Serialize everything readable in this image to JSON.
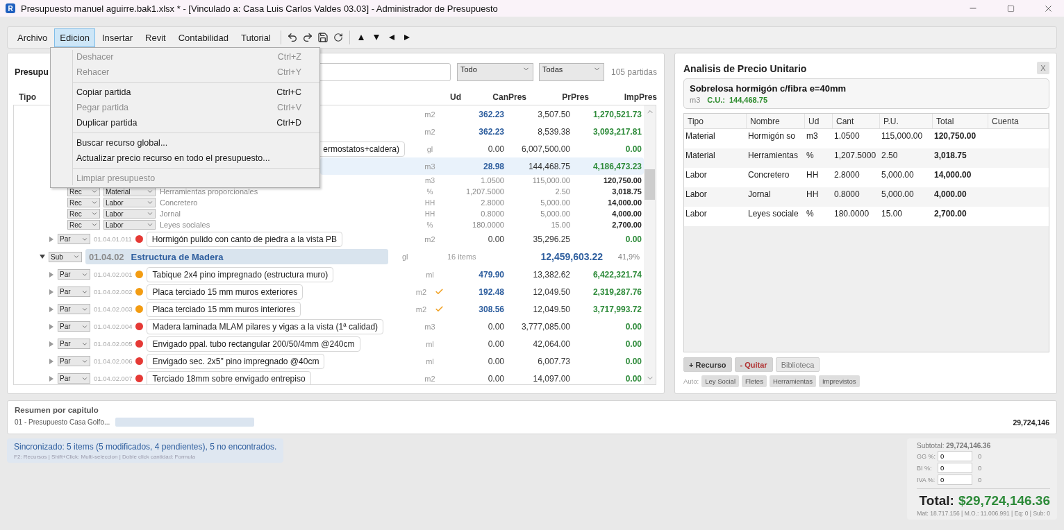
{
  "window": {
    "app_icon": "R",
    "title": "Presupuesto manuel aguirre.bak1.xlsx * - [Vinculado a: Casa Luis Carlos Valdes 03.03] - Administrador de Presupuesto"
  },
  "menu_bar": [
    {
      "label": "Archivo",
      "selected": false
    },
    {
      "label": "Edicion",
      "selected": true
    },
    {
      "label": "Insertar",
      "selected": false
    },
    {
      "label": "Revit",
      "selected": false
    },
    {
      "label": "Contabilidad",
      "selected": false
    },
    {
      "label": "Tutorial",
      "selected": false
    }
  ],
  "edit_menu": [
    {
      "kind": "item",
      "label": "Deshacer",
      "shortcut": "Ctrl+Z",
      "disabled": true
    },
    {
      "kind": "item",
      "label": "Rehacer",
      "shortcut": "Ctrl+Y",
      "disabled": true
    },
    {
      "kind": "separator"
    },
    {
      "kind": "item",
      "label": "Copiar partida",
      "shortcut": "Ctrl+C",
      "disabled": false
    },
    {
      "kind": "item",
      "label": "Pegar partida",
      "shortcut": "Ctrl+V",
      "disabled": true
    },
    {
      "kind": "item",
      "label": "Duplicar partida",
      "shortcut": "Ctrl+D",
      "disabled": false
    },
    {
      "kind": "separator"
    },
    {
      "kind": "item",
      "label": "Buscar recurso global...",
      "disabled": false
    },
    {
      "kind": "item",
      "label": "Actualizar precio recurso en todo el presupuesto...",
      "disabled": false
    },
    {
      "kind": "separator"
    },
    {
      "kind": "item",
      "label": "Limpiar presupuesto",
      "disabled": true
    }
  ],
  "budget": {
    "title": "Presupu",
    "filter_type": "Todo",
    "filter_chapter": "Todas",
    "count": "105 partidas",
    "columns": [
      "Tipo",
      "Ud",
      "CanPres",
      "PrPres",
      "ImpPres"
    ],
    "rows": [
      {
        "kind": "covered",
        "selected": false,
        "ud": "m2",
        "can": "362.23",
        "quantity_set": true,
        "pr": "3,507.50",
        "imp": "1,270,521.73"
      },
      {
        "kind": "covered",
        "selected": false,
        "ud": "m2",
        "can": "362.23",
        "quantity_set": true,
        "pr": "8,539.38",
        "imp": "3,093,217.81"
      },
      {
        "kind": "covered",
        "selected": false,
        "desc": "ermostatos+caldera)",
        "ud": "gl",
        "can": "0.00",
        "quantity_set": false,
        "pr": "6,007,500.00",
        "imp": "0.00"
      },
      {
        "kind": "covered",
        "selected": true,
        "ud": "m3",
        "can": "28.98",
        "quantity_set": true,
        "pr": "144,468.75",
        "imp": "4,186,473.23"
      },
      {
        "kind": "rec",
        "selected": false,
        "ud": "m3",
        "can": "1.0500",
        "pr": "115,000.00",
        "imp": "120,750.00"
      },
      {
        "kind": "rec",
        "selected": false,
        "level_select": "Rec",
        "type_select": "Material",
        "name": "Herramientas proporcionales",
        "ud": "%",
        "can": "1,207.5000",
        "pr": "2.50",
        "imp": "3,018.75"
      },
      {
        "kind": "rec",
        "selected": false,
        "level_select": "Rec",
        "type_select": "Labor",
        "name": "Concretero",
        "ud": "HH",
        "can": "2.8000",
        "pr": "5,000.00",
        "imp": "14,000.00"
      },
      {
        "kind": "rec",
        "selected": false,
        "level_select": "Rec",
        "type_select": "Labor",
        "name": "Jornal",
        "ud": "HH",
        "can": "0.8000",
        "pr": "5,000.00",
        "imp": "4,000.00"
      },
      {
        "kind": "rec",
        "selected": false,
        "level_select": "Rec",
        "type_select": "Labor",
        "name": "Leyes sociales",
        "ud": "%",
        "can": "180.0000",
        "pr": "15.00",
        "imp": "2,700.00"
      },
      {
        "kind": "par",
        "selected": false,
        "expanded": false,
        "level_select": "Par",
        "code": "01.04.01.011",
        "color": "#e53935",
        "desc": "Hormigón pulido con canto de piedra a la vista PB",
        "ud": "m2",
        "verified": false,
        "can": "0.00",
        "quantity_set": false,
        "pr": "35,296.25",
        "imp": "0.00"
      },
      {
        "kind": "sub",
        "selected": false,
        "expanded": true,
        "level_select": "Sub",
        "code": "01.04.02",
        "title": "Estructura de Madera",
        "ud": "gl",
        "items": "16 items",
        "total": "12,459,603.22",
        "share": "41,9%"
      },
      {
        "kind": "par",
        "selected": false,
        "expanded": false,
        "level_select": "Par",
        "code": "01.04.02.001",
        "color": "#f39c12",
        "desc": "Tabique 2x4 pino impregnado (estructura muro)",
        "ud": "ml",
        "verified": false,
        "can": "479.90",
        "quantity_set": true,
        "pr": "13,382.62",
        "imp": "6,422,321.74"
      },
      {
        "kind": "par",
        "selected": false,
        "expanded": false,
        "level_select": "Par",
        "code": "01.04.02.002",
        "color": "#f39c12",
        "desc": "Placa terciado 15 mm muros exteriores",
        "ud": "m2",
        "verified": true,
        "can": "192.48",
        "quantity_set": true,
        "pr": "12,049.50",
        "imp": "2,319,287.76"
      },
      {
        "kind": "par",
        "selected": false,
        "expanded": false,
        "level_select": "Par",
        "code": "01.04.02.003",
        "color": "#f39c12",
        "desc": "Placa terciado 15 mm muros interiores",
        "ud": "m2",
        "verified": true,
        "can": "308.56",
        "quantity_set": true,
        "pr": "12,049.50",
        "imp": "3,717,993.72"
      },
      {
        "kind": "par",
        "selected": false,
        "expanded": false,
        "level_select": "Par",
        "code": "01.04.02.004",
        "color": "#e53935",
        "desc": "Madera laminada MLAM pilares y vigas a la vista (1ª calidad)",
        "ud": "m3",
        "verified": false,
        "can": "0.00",
        "quantity_set": false,
        "pr": "3,777,085.00",
        "imp": "0.00"
      },
      {
        "kind": "par",
        "selected": false,
        "expanded": false,
        "level_select": "Par",
        "code": "01.04.02.005",
        "color": "#e53935",
        "desc": "Envigado ppal. tubo rectangular 200/50/4mm @240cm",
        "ud": "ml",
        "verified": false,
        "can": "0.00",
        "quantity_set": false,
        "pr": "42,064.00",
        "imp": "0.00"
      },
      {
        "kind": "par",
        "selected": false,
        "expanded": false,
        "level_select": "Par",
        "code": "01.04.02.006",
        "color": "#e53935",
        "desc": "Envigado sec. 2x5\" pino impregnado @40cm",
        "ud": "ml",
        "verified": false,
        "can": "0.00",
        "quantity_set": false,
        "pr": "6,007.73",
        "imp": "0.00"
      },
      {
        "kind": "par",
        "selected": false,
        "expanded": false,
        "level_select": "Par",
        "code": "01.04.02.007",
        "color": "#e53935",
        "desc": "Terciado 18mm sobre envigado entrepiso",
        "ud": "m2",
        "verified": false,
        "can": "0.00",
        "quantity_set": false,
        "pr": "14,097.00",
        "imp": "0.00"
      }
    ]
  },
  "apu": {
    "title": "Analisis de Precio Unitario",
    "close": "X",
    "item_name": "Sobrelosa hormigón c/fibra e=40mm",
    "item_ud": "m3",
    "cu_label": "C.U.:",
    "cu": "144,468.75",
    "columns": [
      "Tipo",
      "Nombre",
      "Ud",
      "Cant",
      "P.U.",
      "Total",
      "Cuenta"
    ],
    "rows": [
      {
        "tipo": "Material",
        "nombre": "Hormigón so",
        "ud": "m3",
        "cant": "1.0500",
        "pu": "115,000.00",
        "total": "120,750.00"
      },
      {
        "tipo": "Material",
        "nombre": "Herramientas",
        "ud": "%",
        "cant": "1,207.5000",
        "pu": "2.50",
        "total": "3,018.75"
      },
      {
        "tipo": "Labor",
        "nombre": "Concretero",
        "ud": "HH",
        "cant": "2.8000",
        "pu": "5,000.00",
        "total": "14,000.00"
      },
      {
        "tipo": "Labor",
        "nombre": "Jornal",
        "ud": "HH",
        "cant": "0.8000",
        "pu": "5,000.00",
        "total": "4,000.00"
      },
      {
        "tipo": "Labor",
        "nombre": "Leyes sociale",
        "ud": "%",
        "cant": "180.0000",
        "pu": "15.00",
        "total": "2,700.00"
      }
    ],
    "buttons": [
      {
        "label": "+ Recurso",
        "kind": "primary"
      },
      {
        "label": "- Quitar",
        "kind": "danger"
      },
      {
        "label": "Biblioteca",
        "kind": "plain"
      }
    ],
    "auto_label": "Auto:",
    "auto_buttons": [
      "Ley Social",
      "Fletes",
      "Herramientas",
      "Imprevistos"
    ]
  },
  "summary": {
    "title": "Resumen por capitulo",
    "chapters": [
      {
        "name": "01 - Presupuesto Casa Golfo...",
        "level": 1,
        "total": "29,724,146"
      }
    ]
  },
  "status": {
    "sync": "Sincronizado: 5 items (5 modificados, 4 pendientes), 5 no encontrados.",
    "hint": "F2: Recursos | Shift+Click: Multi-seleccion | Doble click cantidad: Formula"
  },
  "totals": {
    "subtotal_label": "Subtotal:",
    "subtotal": "29,724,146.36",
    "rates": [
      {
        "label": "GG %:",
        "value": "0",
        "result": "0"
      },
      {
        "label": "BI %:",
        "value": "0",
        "result": "0"
      },
      {
        "label": "IVA %:",
        "value": "0",
        "result": "0"
      }
    ],
    "total_label": "Total:",
    "total": "$29,724,146.36",
    "breakdown": "Mat: 18.717.156 | M.O.: 11.006.991 | Eq: 0 | Sub: 0"
  }
}
